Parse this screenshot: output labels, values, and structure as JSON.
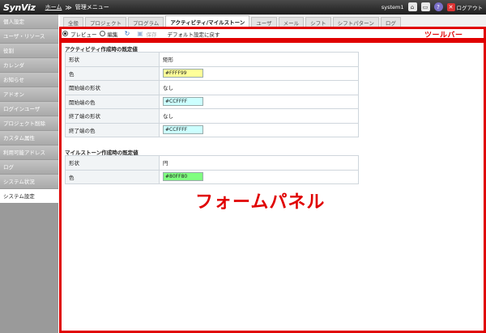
{
  "header": {
    "logo": "SynViz",
    "home_link": "ホーム",
    "separator": "≫",
    "page": "管理メニュー",
    "user": "system1",
    "logout_label": "ログアウト"
  },
  "sidebar": {
    "items": [
      {
        "label": "個人設定",
        "active": false
      },
      {
        "label": "ユーザ・リソース",
        "active": false
      },
      {
        "label": "役割",
        "active": false
      },
      {
        "label": "カレンダ",
        "active": false
      },
      {
        "label": "お知らせ",
        "active": false
      },
      {
        "label": "アドオン",
        "active": false
      },
      {
        "label": "ログインユーザ",
        "active": false
      },
      {
        "label": "プロジェクト削除",
        "active": false
      },
      {
        "label": "カスタム属性",
        "active": false
      },
      {
        "label": "利用可能アドレス",
        "active": false
      },
      {
        "label": "ログ",
        "active": false
      },
      {
        "label": "システム状況",
        "active": false
      },
      {
        "label": "システム設定",
        "active": true
      }
    ]
  },
  "tabs": [
    {
      "label": "全般",
      "active": false
    },
    {
      "label": "プロジェクト",
      "active": false
    },
    {
      "label": "プログラム",
      "active": false
    },
    {
      "label": "アクティビティ/マイルストーン",
      "active": true
    },
    {
      "label": "ユーザ",
      "active": false
    },
    {
      "label": "メール",
      "active": false
    },
    {
      "label": "シフト",
      "active": false
    },
    {
      "label": "シフトパターン",
      "active": false
    },
    {
      "label": "ログ",
      "active": false
    }
  ],
  "toolbar": {
    "preview_label": "プレビュー",
    "edit_label": "編集",
    "save_label": "保存",
    "reset_label": "デフォルト設定に戻す",
    "mode": "preview"
  },
  "annotations": {
    "toolbar": "ツールバー",
    "form": "フォームパネル"
  },
  "activity_section": {
    "title": "アクティビティ作成時の既定値",
    "rows": [
      {
        "label": "形状",
        "value": "矩形",
        "color": null
      },
      {
        "label": "色",
        "value": "#FFFF99",
        "color": "#FFFF99"
      },
      {
        "label": "開始端の形状",
        "value": "なし",
        "color": null
      },
      {
        "label": "開始端の色",
        "value": "#CCFFFF",
        "color": "#CCFFFF"
      },
      {
        "label": "終了端の形状",
        "value": "なし",
        "color": null
      },
      {
        "label": "終了端の色",
        "value": "#CCFFFF",
        "color": "#CCFFFF"
      }
    ]
  },
  "milestone_section": {
    "title": "マイルストーン作成時の既定値",
    "rows": [
      {
        "label": "形状",
        "value": "円",
        "color": null
      },
      {
        "label": "色",
        "value": "#80FF80",
        "color": "#80FF80"
      }
    ]
  },
  "colors": {
    "annotation_red": "#e00000"
  }
}
